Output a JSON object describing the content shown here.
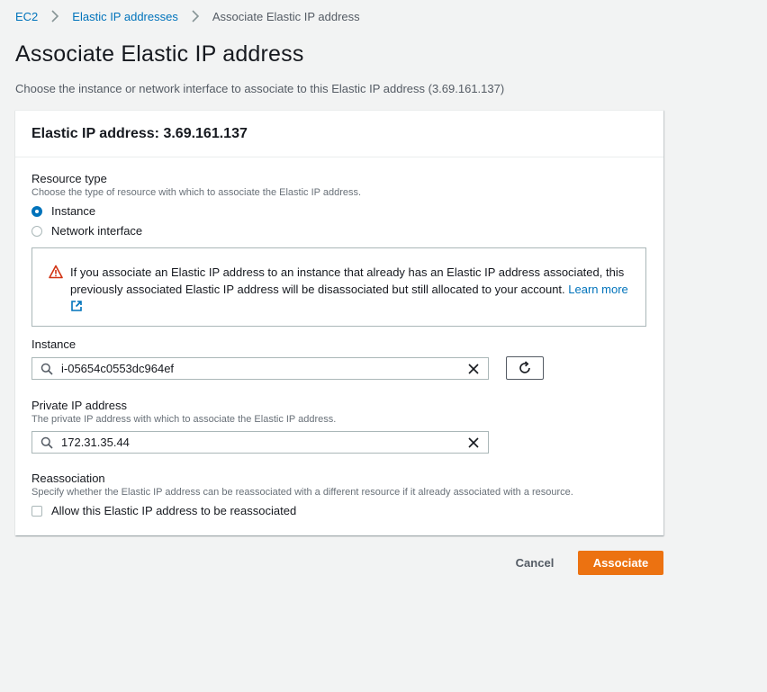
{
  "breadcrumb": {
    "items": [
      "EC2",
      "Elastic IP addresses",
      "Associate Elastic IP address"
    ]
  },
  "page": {
    "title": "Associate Elastic IP address",
    "description": "Choose the instance or network interface to associate to this Elastic IP address (3.69.161.137)"
  },
  "panel": {
    "title": "Elastic IP address: 3.69.161.137"
  },
  "resource_type": {
    "label": "Resource type",
    "description": "Choose the type of resource with which to associate the Elastic IP address.",
    "options": [
      {
        "label": "Instance",
        "selected": true
      },
      {
        "label": "Network interface",
        "selected": false
      }
    ]
  },
  "alert": {
    "text": "If you associate an Elastic IP address to an instance that already has an Elastic IP address associated, this previously associated Elastic IP address will be disassociated but still allocated to your account.",
    "link": "Learn more",
    "icon": "warning-icon"
  },
  "instance": {
    "label": "Instance",
    "value": "i-05654c0553dc964ef"
  },
  "private_ip": {
    "label": "Private IP address",
    "description": "The private IP address with which to associate the Elastic IP address.",
    "value": "172.31.35.44"
  },
  "reassociation": {
    "label": "Reassociation",
    "description": "Specify whether the Elastic IP address can be reassociated with a different resource if it already associated with a resource.",
    "checkbox_label": "Allow this Elastic IP address to be reassociated",
    "checked": false
  },
  "actions": {
    "cancel": "Cancel",
    "associate": "Associate"
  },
  "colors": {
    "primary": "#ec7211",
    "link": "#0073bb",
    "warning": "#d13212"
  }
}
